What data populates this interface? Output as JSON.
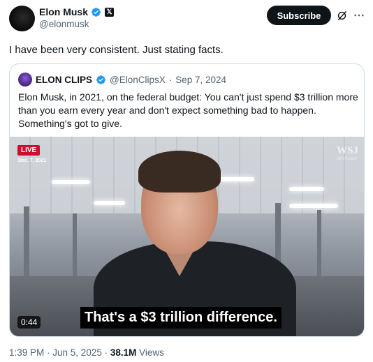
{
  "author": {
    "name": "Elon Musk",
    "handle": "@elonmusk"
  },
  "actions": {
    "subscribe_label": "Subscribe",
    "grok_icon": "grok-icon",
    "more_icon": "more-icon"
  },
  "tweet": {
    "text": "I have been very consistent. Just stating facts."
  },
  "quote": {
    "author_name": "ELON CLIPS",
    "author_handle": "@ElonClipsX",
    "separator": "·",
    "date": "Sep 7, 2024",
    "text": "Elon Musk, in 2021, on the federal budget: You can't just spend $3 trillion more than you earn every year and don't expect something bad to happen. Something's got to give."
  },
  "video": {
    "live_label": "LIVE",
    "date_label": "Dec. 7, 2021",
    "brand": "WSJ",
    "brand_sub": "CEO Council",
    "caption": "That's a $3 trillion difference.",
    "duration": "0:44"
  },
  "footer": {
    "time": "1:39 PM",
    "sep1": " · ",
    "date": "Jun 5, 2025",
    "sep2": " · ",
    "views_count": "38.1M",
    "views_label": " Views"
  },
  "colors": {
    "verified_blue": "#1d9bf0",
    "live_red": "#c8102e",
    "text_secondary": "#536471"
  }
}
